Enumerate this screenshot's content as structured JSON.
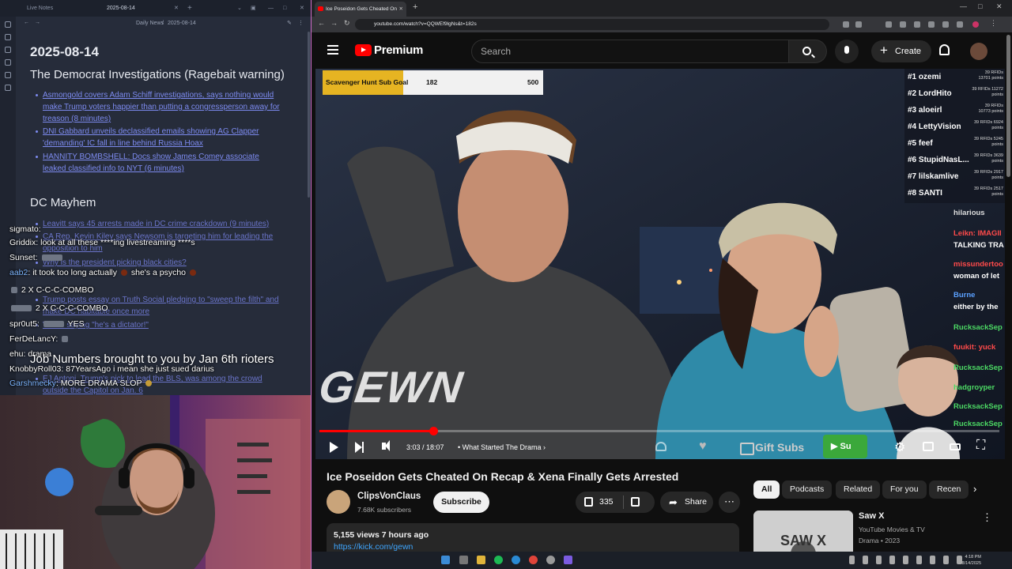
{
  "notes_app": {
    "tab_left": "Live Notes",
    "tab_active": "2025-08-14",
    "breadcrumb_folder": "Daily News",
    "breadcrumb_file": "2025-08-14",
    "date_heading": "2025-08-14",
    "section1_title": "The Democrat Investigations (Ragebait warning)",
    "section1_items": [
      "Asmongold covers Adam Schiff investigations, says nothing would make Trump voters happier than putting a congressperson away for treason (8 minutes)",
      "DNI Gabbard unveils declassified emails showing AG Clapper 'demanding' IC fall in line behind Russia Hoax",
      "HANNITY BOMBSHELL: Docs show James Comey associate leaked classified info to NYT (6 minutes)"
    ],
    "section2_title": "DC Mayhem",
    "section2_items": [
      "Leavitt says 45 arrests made in DC crime crackdown (9 minutes)",
      "CA Rep. Kevin Kiley says Newsom is targeting him for leading the opposition to him",
      "Why is the president picking black cities?",
      "Trump posts essay on Truth Social pledging to \"sweep the filth\" and make DC habitable once more",
      "Vance saying \"he's a dictator!\""
    ],
    "section3_title": "Job Numbers brought to you by Jan 6th rioters",
    "section3_items": [
      "EJ Antoni, Trump's pick to lead the BLS, was among the crowd outside the Capitol on Jan. 6"
    ]
  },
  "stream_chat": [
    {
      "user": "sigmato",
      "text": ""
    },
    {
      "user": "Griddix",
      "text": "look at all these ****ing livestreaming ****s"
    },
    {
      "user": "Sunset",
      "text": ""
    },
    {
      "user": "aab2",
      "text": "it took too long actually",
      "text2": "she's a psycho"
    },
    {
      "user": "",
      "text": "2 X C-C-C-COMBO"
    },
    {
      "user": "",
      "text": "2 X C-C-C-COMBO"
    },
    {
      "user": "spr0ut5",
      "text": "YES"
    },
    {
      "user": "FerDeLancY",
      "text": ""
    },
    {
      "user": "ehu",
      "text": "drama"
    },
    {
      "user": "KnobbyRoll03",
      "text": "87YearsAgo i mean she just sued darius"
    },
    {
      "user": "Garshmecky",
      "text": "MORE DRAMA SLOP"
    }
  ],
  "browser": {
    "tab_title": "Ice Poseidon Gets Cheated On",
    "url": "youtube.com/watch?v=QQWEf9lgNs&t=182s"
  },
  "youtube": {
    "brand": "Premium",
    "search_placeholder": "Search",
    "create_label": "Create",
    "goal": {
      "label": "Scavenger Hunt Sub Goal",
      "current": "182",
      "target": "500",
      "fraction": 0.364
    },
    "leaderboard": [
      {
        "rank": "#1 ozemi",
        "pts": "39 RFIDs 13701 points"
      },
      {
        "rank": "#2 LordHito",
        "pts": "39 RFIDs 11272 points"
      },
      {
        "rank": "#3 aloeirl",
        "pts": "39 RFIDs 10773 points"
      },
      {
        "rank": "#4 LettyVision",
        "pts": "39 RFIDs 6924 points"
      },
      {
        "rank": "#5 feef",
        "pts": "39 RFIDs 5245 points"
      },
      {
        "rank": "#6 StupidNasL...",
        "pts": "39 RFIDs 3639 points"
      },
      {
        "rank": "#7 lilskamlive",
        "pts": "39 RFIDs 2917 points"
      },
      {
        "rank": "#8 SANTI",
        "pts": "39 RFIDs 2517 points"
      }
    ],
    "side_chat": [
      {
        "text": "hilarious",
        "color": "#dddddd"
      },
      {
        "text": "Leikn: IMAGII",
        "color": "#ff4a4a"
      },
      {
        "text": "TALKING TRA",
        "color": "#ffffff"
      },
      {
        "text": "missundertoo",
        "color": "#ff4a4a"
      },
      {
        "text": "woman of let",
        "color": "#ffffff"
      },
      {
        "text": "Burne",
        "color": "#5aa0ff"
      },
      {
        "text": "either by the",
        "color": "#ffffff"
      },
      {
        "text": "RucksackSep",
        "color": "#4cd964"
      },
      {
        "text": "fuukit: yuck",
        "color": "#ff4a4a"
      },
      {
        "text": "RucksackSep",
        "color": "#4cd964"
      },
      {
        "text": "hadgroyper",
        "color": "#4cd964"
      },
      {
        "text": "RucksackSep",
        "color": "#4cd964"
      },
      {
        "text": "RucksackSep",
        "color": "#4cd964"
      }
    ],
    "watermark": "GEWN",
    "player": {
      "timecode": "3:03 / 18:07",
      "chapter": "What Started The Drama",
      "gift_subs": "Gift Subs",
      "progress": 0.168
    },
    "video_title": "Ice Poseidon Gets Cheated On Recap & Xena Finally Gets Arrested",
    "channel_name": "ClipsVonClaus",
    "channel_subs": "7.68K subscribers",
    "subscribe_label": "Subscribe",
    "likes": "335",
    "share_label": "Share",
    "views_line": "5,155 views  7 hours ago",
    "desc_link": "https://kick.com/gewn",
    "chips": [
      "All",
      "Podcasts",
      "Related",
      "For you",
      "Recen"
    ],
    "rec": {
      "title": "Saw X",
      "channel": "YouTube Movies & TV",
      "meta": "Drama • 2023",
      "thumb_text": "SAW X"
    }
  },
  "taskbar": {
    "time": "4:18 PM",
    "date": "8/14/2025"
  }
}
